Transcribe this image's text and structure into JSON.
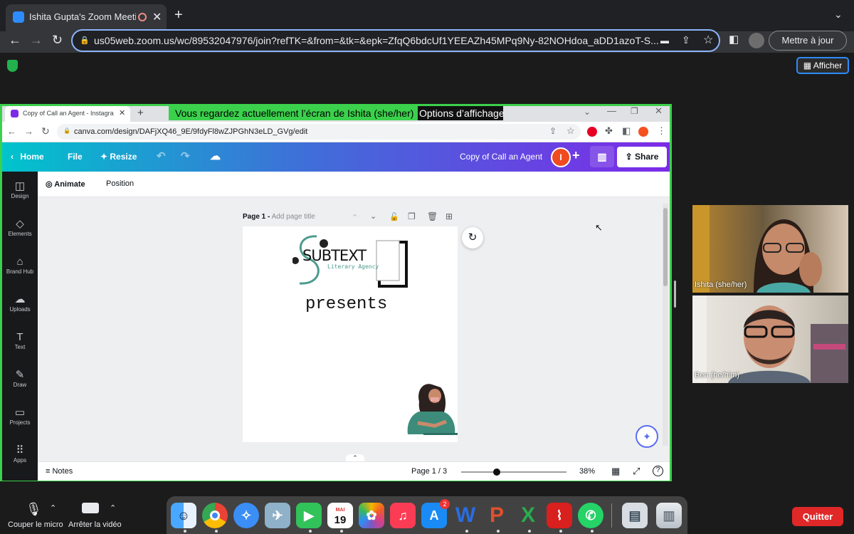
{
  "outer_browser": {
    "tab_title": "Ishita Gupta's Zoom Meetin",
    "url": "us05web.zoom.us/wc/89532047976/join?refTK=&from=&tk=&epk=ZfqQ6bdcUf1YEEAZh45MPq9Ny-82NOHdoa_aDD1azoT-S...",
    "update_label": "Mettre à jour"
  },
  "zoom": {
    "view_label": "Afficher",
    "share_banner": "Vous regardez actuellement l’écran de Ishita (she/her)",
    "view_options": "Options d’affichage",
    "mute_label": "Couper le micro",
    "video_label": "Arrêter la vidéo",
    "quit_label": "Quitter",
    "participants": [
      {
        "name": "Ishita (she/her)"
      },
      {
        "name": "Ben (he/him)"
      }
    ]
  },
  "shared_browser": {
    "tab_title": "Copy of Call an Agent - Instagram",
    "url": "canva.com/design/DAFjXQ46_9E/9fdyFl8wZJPGhN3eLD_GVg/edit"
  },
  "canva": {
    "home": "Home",
    "file": "File",
    "resize": "Resize",
    "doc_title": "Copy of Call an Agent",
    "avatar_letter": "I",
    "share": "Share",
    "animate": "Animate",
    "position": "Position",
    "sidebar": [
      "Design",
      "Elements",
      "Brand Hub",
      "Uploads",
      "Text",
      "Draw",
      "Projects",
      "Apps"
    ],
    "page_label": "Page 1 -",
    "page_title_placeholder": "Add page title",
    "logo_main": "SUBTEXT",
    "logo_sub": "Literary Agency",
    "presents": "presents",
    "notes": "Notes",
    "page_count": "Page 1 / 3",
    "zoom_level": "38%"
  },
  "dock": {
    "calendar_month": "MAI",
    "calendar_day": "19",
    "appstore_badge": "2"
  },
  "colors": {
    "share_green": "#3bd14c",
    "canva_purple": "#7d2ae8",
    "quit_red": "#e02828"
  }
}
